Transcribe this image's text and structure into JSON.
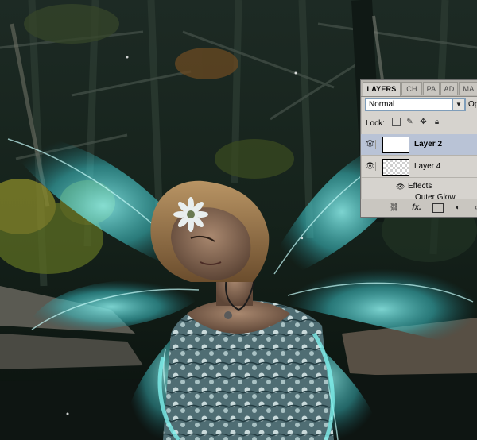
{
  "layers_panel": {
    "tabs": [
      {
        "label": "LAYERS",
        "active": true
      },
      {
        "label": "CH",
        "active": false
      },
      {
        "label": "PA",
        "active": false
      },
      {
        "label": "AD",
        "active": false
      },
      {
        "label": "MA",
        "active": false
      }
    ],
    "blend_mode": "Normal",
    "opacity_label": "Op",
    "lock_label": "Lock:",
    "layers": [
      {
        "name": "Layer 2",
        "selected": true,
        "visible": true
      },
      {
        "name": "Layer 4",
        "selected": false,
        "visible": true
      }
    ],
    "effects_label": "Effects",
    "outer_glow_label": "Outer Glow",
    "bottom_icons": [
      "link-icon",
      "fx-icon",
      "mask-icon",
      "adjustment-icon",
      "group-icon"
    ],
    "bottom_fx_label": "fx."
  },
  "colors": {
    "panel_bg": "#d6d3ce",
    "selected_row": "#b9c3d6",
    "wing_glow": "#4fd6d8"
  }
}
